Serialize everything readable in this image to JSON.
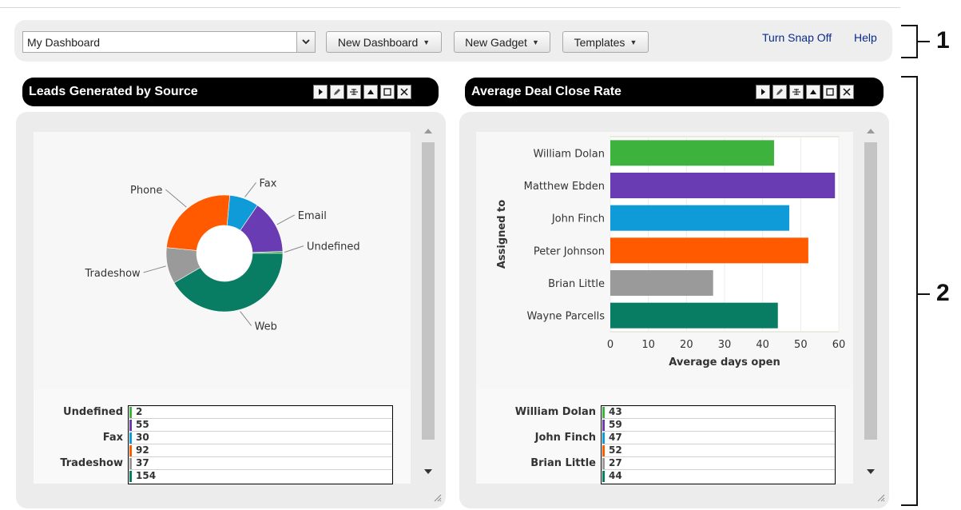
{
  "toolbar": {
    "dashboard_select": "My Dashboard",
    "new_dashboard": "New Dashboard",
    "new_gadget": "New Gadget",
    "templates": "Templates",
    "snap": "Turn Snap Off",
    "help": "Help"
  },
  "callouts": {
    "one": "1",
    "two": "2"
  },
  "colors": {
    "green": "#3db33d",
    "purple": "#6a3cb4",
    "blue": "#0e9bd8",
    "orange": "#ff5a00",
    "gray": "#9a9a9a",
    "teal": "#087d63"
  },
  "gadget_left": {
    "title": "Leads Generated by Source",
    "table_labels": [
      "Undefined",
      "Fax",
      "Tradeshow"
    ],
    "table_values": [
      "2",
      "55",
      "30",
      "92",
      "37",
      "154"
    ]
  },
  "gadget_right": {
    "title": "Average Deal Close Rate",
    "table_labels": [
      "William Dolan",
      "John Finch",
      "Brian Little"
    ],
    "table_values": [
      "43",
      "59",
      "47",
      "52",
      "27",
      "44"
    ]
  },
  "chart_data": [
    {
      "type": "pie",
      "title": "Leads Generated by Source",
      "donut": true,
      "slices": [
        {
          "label": "Undefined",
          "value": 2,
          "color": "#3db33d"
        },
        {
          "label": "Web",
          "value": 154,
          "color": "#087d63"
        },
        {
          "label": "Tradeshow",
          "value": 37,
          "color": "#9a9a9a"
        },
        {
          "label": "Phone",
          "value": 92,
          "color": "#ff5a00"
        },
        {
          "label": "Fax",
          "value": 30,
          "color": "#0e9bd8"
        },
        {
          "label": "Email",
          "value": 55,
          "color": "#6a3cb4"
        }
      ]
    },
    {
      "type": "bar",
      "orientation": "horizontal",
      "title": "Average Deal Close Rate",
      "categories": [
        "William Dolan",
        "Matthew Ebden",
        "John Finch",
        "Peter Johnson",
        "Brian Little",
        "Wayne Parcells"
      ],
      "values": [
        43,
        59,
        47,
        52,
        27,
        44
      ],
      "colors": [
        "#3db33d",
        "#6a3cb4",
        "#0e9bd8",
        "#ff5a00",
        "#9a9a9a",
        "#087d63"
      ],
      "xlabel": "Average days open",
      "ylabel": "Assigned to",
      "xlim": [
        0,
        60
      ],
      "xticks": [
        "0",
        "10",
        "20",
        "30",
        "40",
        "50",
        "60"
      ],
      "grid": true
    }
  ]
}
